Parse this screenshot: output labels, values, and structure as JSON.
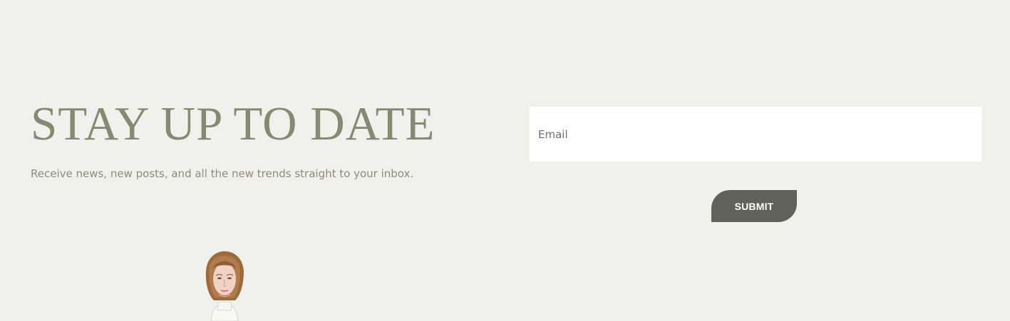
{
  "newsletter": {
    "heading": "STAY UP TO DATE",
    "subtext": "Receive news, new posts, and all the new trends straight to your inbox.",
    "email_placeholder": "Email",
    "email_value": "",
    "submit_label": "SUBMIT"
  },
  "illustration": {
    "subject": "fashion-sketch-woman-portrait"
  },
  "colors": {
    "background": "#f0f1ec",
    "heading": "#858a70",
    "subtext": "#8f8a7c",
    "button_background": "#61615c",
    "button_text": "#ffffff",
    "input_background": "#ffffff"
  }
}
